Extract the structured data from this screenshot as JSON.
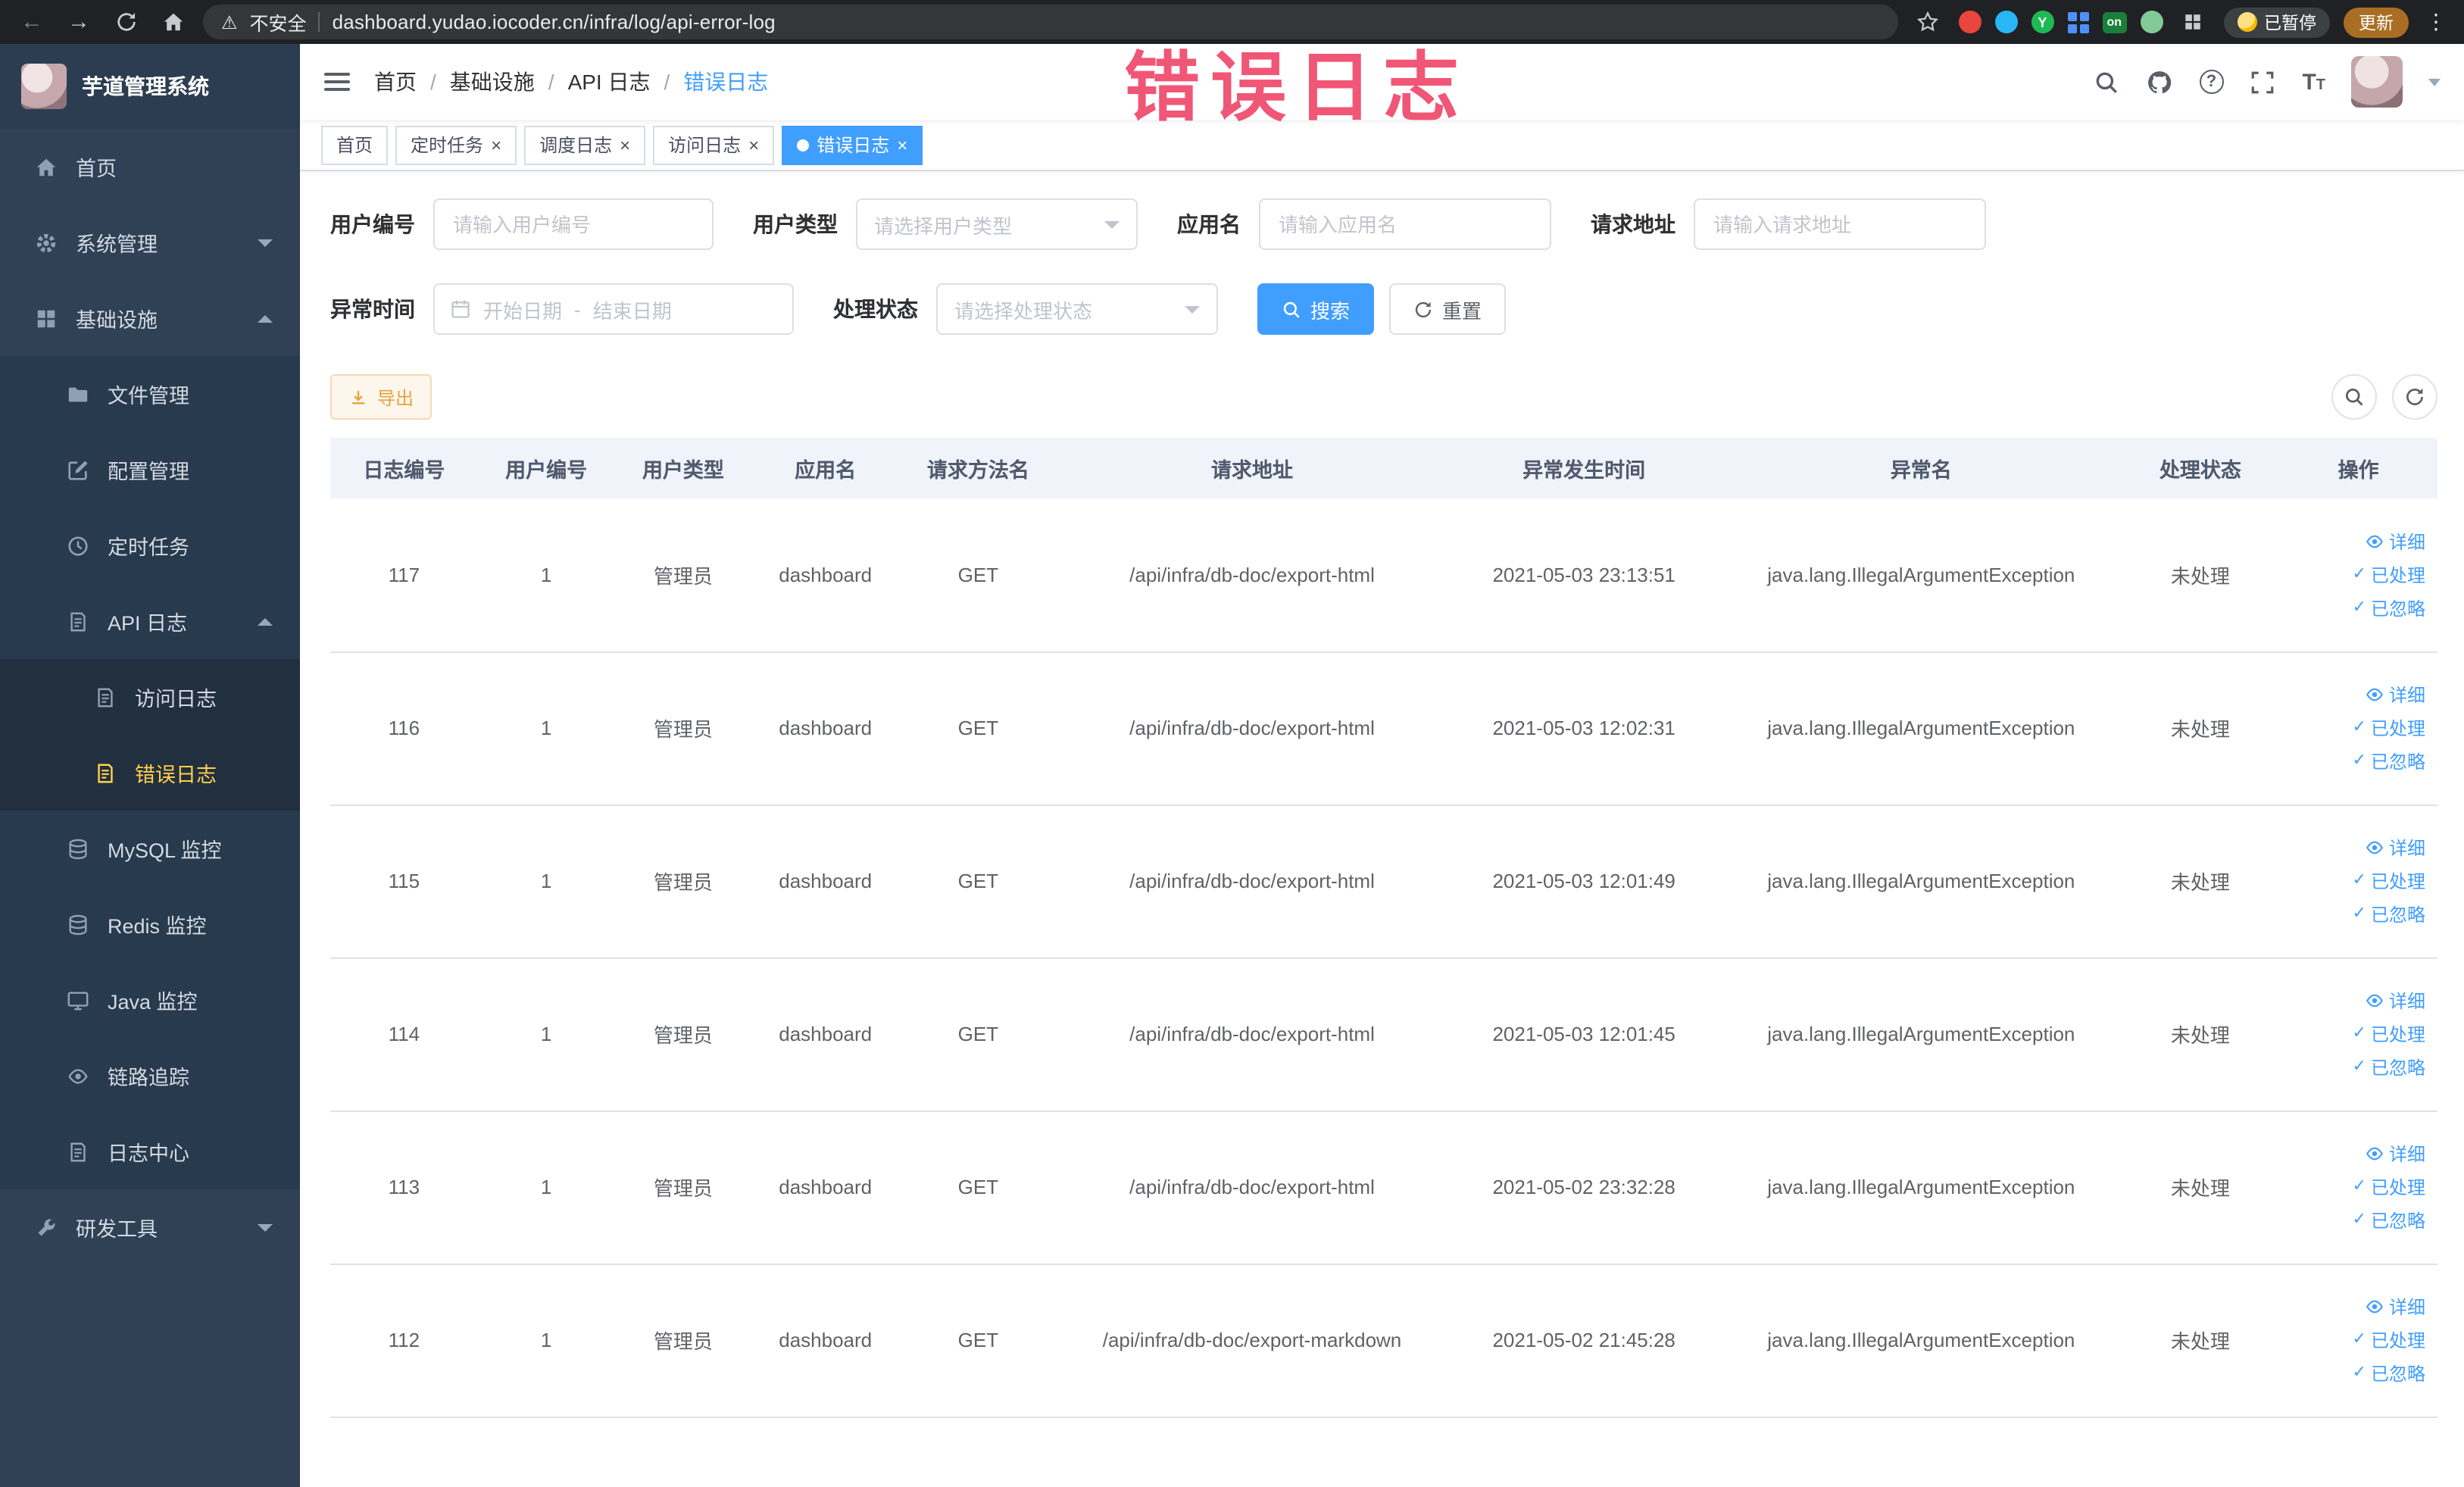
{
  "browser": {
    "security_label": "不安全",
    "url": "dashboard.yudao.iocoder.cn/infra/log/api-error-log",
    "paused_label": "已暂停",
    "update_label": "更新",
    "ext_y_label": "Y",
    "ext_on_label": "on"
  },
  "overlay": {
    "text": "错误日志"
  },
  "sidebar": {
    "logo_title": "芋道管理系统",
    "items": [
      {
        "label": "首页",
        "icon": "home-icon",
        "level": 1
      },
      {
        "label": "系统管理",
        "icon": "gear-icon",
        "level": 1,
        "state": "collapsed"
      },
      {
        "label": "基础设施",
        "icon": "grid-icon",
        "level": 1,
        "state": "expanded"
      },
      {
        "label": "文件管理",
        "icon": "folder-icon",
        "level": 2
      },
      {
        "label": "配置管理",
        "icon": "edit-icon",
        "level": 2
      },
      {
        "label": "定时任务",
        "icon": "clock-icon",
        "level": 2
      },
      {
        "label": "API 日志",
        "icon": "doc-icon",
        "level": 2,
        "state": "expanded"
      },
      {
        "label": "访问日志",
        "icon": "doc-icon",
        "level": 3
      },
      {
        "label": "错误日志",
        "icon": "doc-icon",
        "level": 3,
        "active": true
      },
      {
        "label": "MySQL 监控",
        "icon": "database-icon",
        "level": 2
      },
      {
        "label": "Redis 监控",
        "icon": "database-icon",
        "level": 2
      },
      {
        "label": "Java 监控",
        "icon": "monitor-icon",
        "level": 2
      },
      {
        "label": "链路追踪",
        "icon": "eye-icon",
        "level": 2
      },
      {
        "label": "日志中心",
        "icon": "doc-icon",
        "level": 2
      },
      {
        "label": "研发工具",
        "icon": "wrench-icon",
        "level": 1,
        "state": "collapsed"
      }
    ]
  },
  "header": {
    "breadcrumb": [
      "首页",
      "基础设施",
      "API 日志",
      "错误日志"
    ]
  },
  "tabs": [
    {
      "label": "首页",
      "closable": false,
      "active": false
    },
    {
      "label": "定时任务",
      "closable": true,
      "active": false
    },
    {
      "label": "调度日志",
      "closable": true,
      "active": false
    },
    {
      "label": "访问日志",
      "closable": true,
      "active": false
    },
    {
      "label": "错误日志",
      "closable": true,
      "active": true
    }
  ],
  "filters": {
    "user_id": {
      "label": "用户编号",
      "placeholder": "请输入用户编号"
    },
    "user_type": {
      "label": "用户类型",
      "placeholder": "请选择用户类型"
    },
    "app_name": {
      "label": "应用名",
      "placeholder": "请输入应用名"
    },
    "request_url": {
      "label": "请求地址",
      "placeholder": "请输入请求地址"
    },
    "exception_time": {
      "label": "异常时间",
      "start_placeholder": "开始日期",
      "separator": "-",
      "end_placeholder": "结束日期"
    },
    "process_status": {
      "label": "处理状态",
      "placeholder": "请选择处理状态"
    },
    "search_label": "搜索",
    "reset_label": "重置"
  },
  "toolbar": {
    "export_label": "导出"
  },
  "table": {
    "columns": [
      "日志编号",
      "用户编号",
      "用户类型",
      "应用名",
      "请求方法名",
      "请求地址",
      "异常发生时间",
      "异常名",
      "处理状态",
      "操作"
    ],
    "actions": [
      "详细",
      "已处理",
      "已忽略"
    ],
    "rows": [
      {
        "id": "117",
        "user_id": "1",
        "user_type": "管理员",
        "app": "dashboard",
        "method": "GET",
        "url": "/api/infra/db-doc/export-html",
        "time": "2021-05-03 23:13:51",
        "exception": "java.lang.IllegalArgumentException",
        "status": "未处理"
      },
      {
        "id": "116",
        "user_id": "1",
        "user_type": "管理员",
        "app": "dashboard",
        "method": "GET",
        "url": "/api/infra/db-doc/export-html",
        "time": "2021-05-03 12:02:31",
        "exception": "java.lang.IllegalArgumentException",
        "status": "未处理"
      },
      {
        "id": "115",
        "user_id": "1",
        "user_type": "管理员",
        "app": "dashboard",
        "method": "GET",
        "url": "/api/infra/db-doc/export-html",
        "time": "2021-05-03 12:01:49",
        "exception": "java.lang.IllegalArgumentException",
        "status": "未处理"
      },
      {
        "id": "114",
        "user_id": "1",
        "user_type": "管理员",
        "app": "dashboard",
        "method": "GET",
        "url": "/api/infra/db-doc/export-html",
        "time": "2021-05-03 12:01:45",
        "exception": "java.lang.IllegalArgumentException",
        "status": "未处理"
      },
      {
        "id": "113",
        "user_id": "1",
        "user_type": "管理员",
        "app": "dashboard",
        "method": "GET",
        "url": "/api/infra/db-doc/export-html",
        "time": "2021-05-02 23:32:28",
        "exception": "java.lang.IllegalArgumentException",
        "status": "未处理"
      },
      {
        "id": "112",
        "user_id": "1",
        "user_type": "管理员",
        "app": "dashboard",
        "method": "GET",
        "url": "/api/infra/db-doc/export-markdown",
        "time": "2021-05-02 21:45:28",
        "exception": "java.lang.IllegalArgumentException",
        "status": "未处理"
      }
    ]
  },
  "colors": {
    "accent": "#409eff",
    "sidebar_bg": "#304156",
    "sidebar_active": "#ffd04b",
    "warning": "#e6a23c",
    "overlay_annotation": "#ee3f63"
  }
}
